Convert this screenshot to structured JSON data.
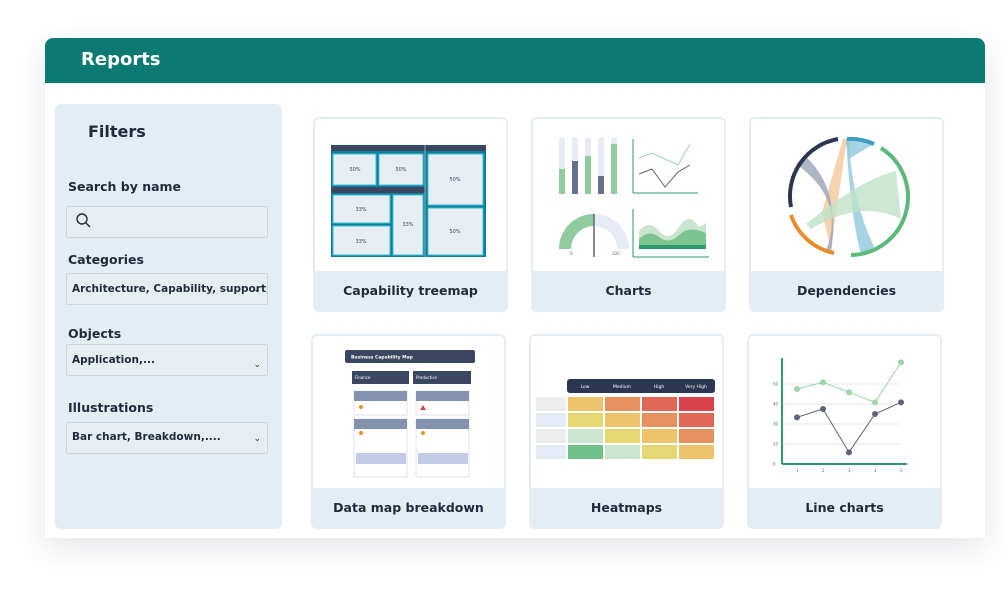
{
  "header": {
    "title": "Reports"
  },
  "filters": {
    "title": "Filters",
    "search_label": "Search by name",
    "search_placeholder": "",
    "categories_label": "Categories",
    "categories_value": "Architecture, Capability, support, ...",
    "objects_label": "Objects",
    "objects_value": "Application,...",
    "illustrations_label": "Illustrations",
    "illustrations_value": "Bar chart, Breakdown,...."
  },
  "cards": [
    {
      "label": "Capability treemap",
      "thumb": {
        "cells": [
          "50%",
          "50%",
          "50%",
          "33%",
          "33%",
          "33%",
          "50%"
        ]
      }
    },
    {
      "label": "Charts",
      "thumb": {
        "gauge_min": "0",
        "gauge_max": "100"
      }
    },
    {
      "label": "Dependencies"
    },
    {
      "label": "Data map breakdown",
      "thumb": {
        "title": "Business Capability Map",
        "columns": [
          "Finance",
          "Production"
        ]
      }
    },
    {
      "label": "Heatmaps",
      "thumb": {
        "columns": [
          "Low",
          "Medium",
          "High",
          "Very High"
        ],
        "colors": [
          [
            "#efc36b",
            "#e4915e",
            "#e06756",
            "#d9414b"
          ],
          [
            "#e5d774",
            "#efc36b",
            "#e4915e",
            "#e06756"
          ],
          [
            "#c9e4cf",
            "#e5d774",
            "#efc36b",
            "#e4915e"
          ],
          [
            "#6fbf88",
            "#c9e4cf",
            "#e5d774",
            "#efc36b"
          ]
        ]
      }
    },
    {
      "label": "Line charts",
      "thumb": {
        "x": [
          "1",
          "2",
          "3",
          "4",
          "5"
        ],
        "yticks": [
          "0",
          "20",
          "30",
          "40",
          "50"
        ],
        "series": [
          {
            "color": "#9fd3a8",
            "values": [
              45,
              49,
              43,
              37,
              61
            ]
          },
          {
            "color": "#5b6478",
            "values": [
              28,
              33,
              7,
              30,
              37
            ]
          }
        ]
      }
    }
  ],
  "colors": {
    "header": "#0a7a72",
    "panel": "#e3edf3",
    "accent_green": "#2e9a6a"
  }
}
